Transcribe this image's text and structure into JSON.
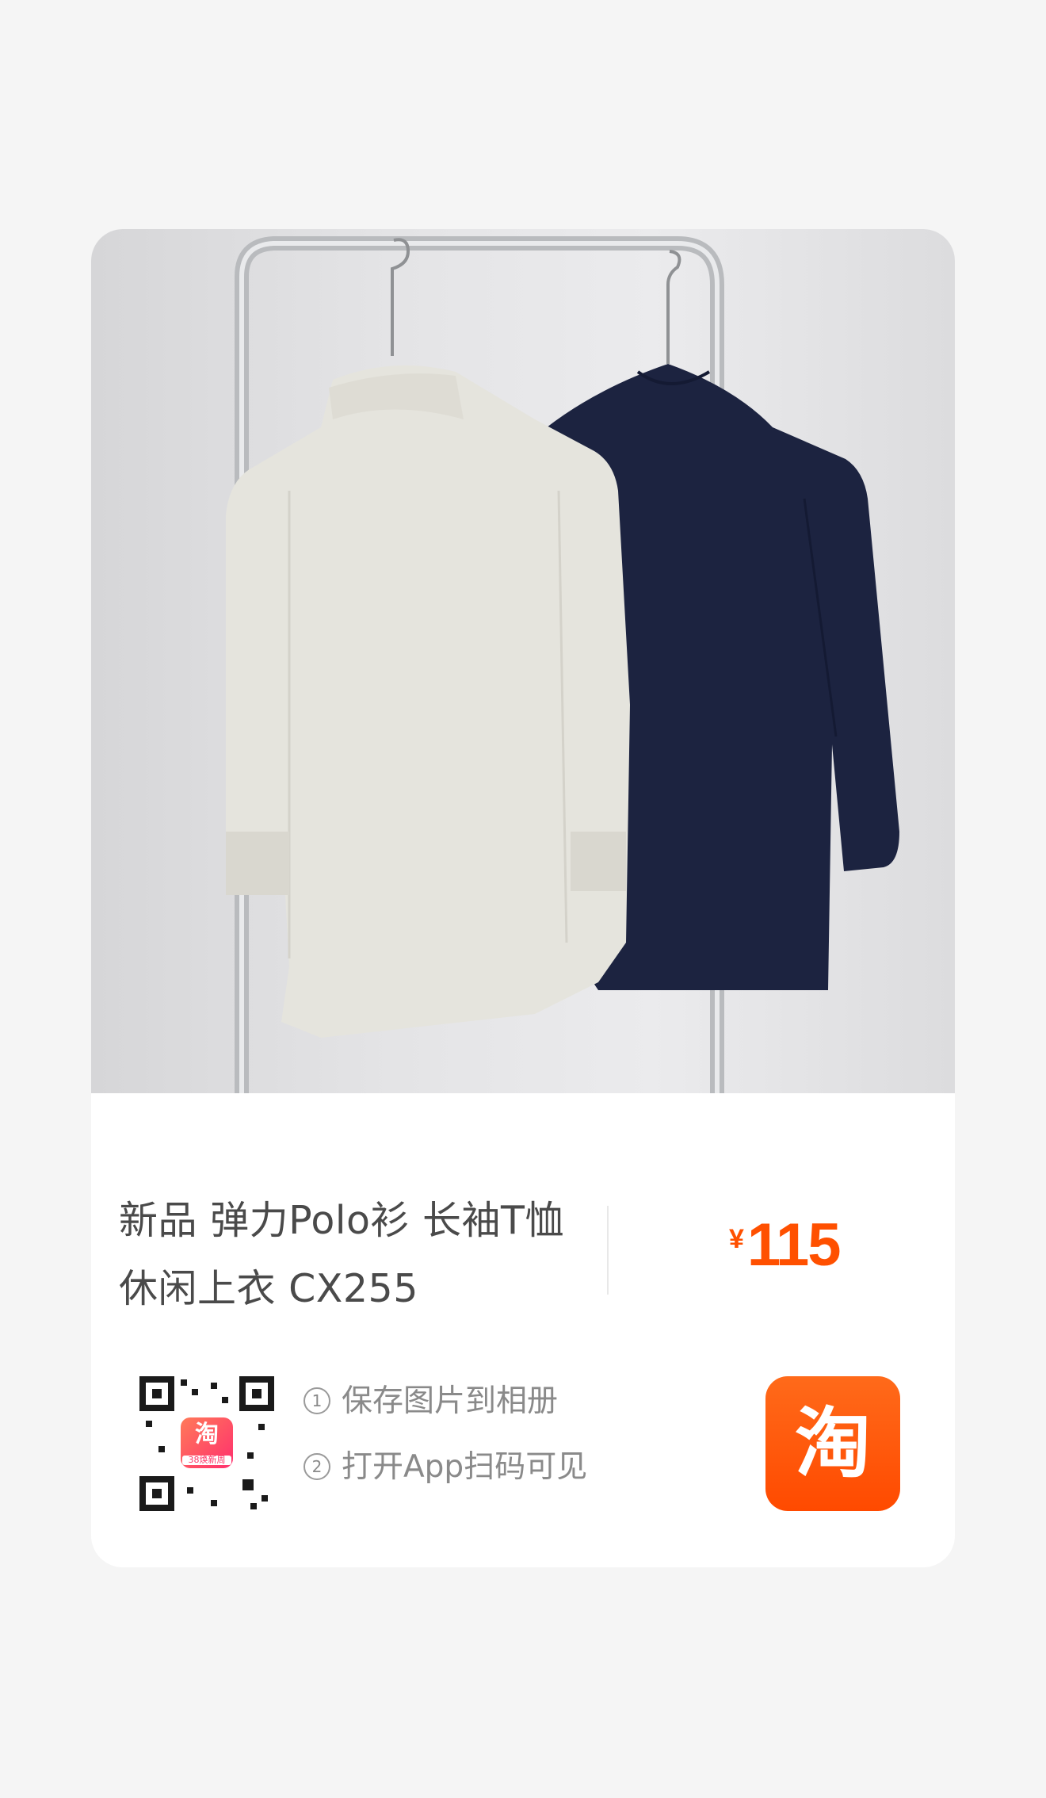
{
  "product": {
    "title_line1": "新品 弹力Polo衫 长袖T恤",
    "title_line2": "休闲上衣 CX255",
    "price_symbol": "¥",
    "price_value": "115"
  },
  "share": {
    "step1_num": "1",
    "step1_text": "保存图片到相册",
    "step2_num": "2",
    "step2_text": "打开App扫码可见",
    "qr_logo_text": "淘",
    "qr_logo_badge": "38焕新周",
    "app_logo_text": "淘"
  },
  "icons": {
    "product_image": "clothing-rack-photo",
    "qr_code": "qr-code-icon",
    "app_logo": "taobao-logo-icon"
  },
  "colors": {
    "price": "#ff5000",
    "app_logo_bg": "#ff5000",
    "title_text": "#4a4a4a",
    "step_text": "#8a8a8a"
  }
}
